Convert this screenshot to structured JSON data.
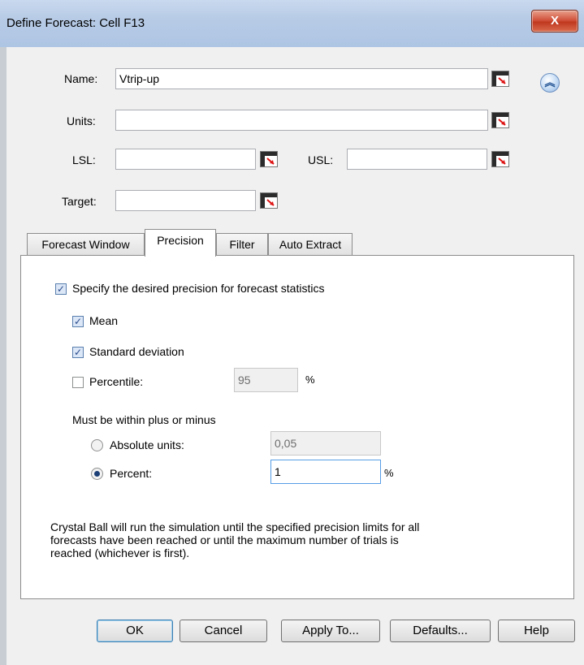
{
  "window": {
    "title": "Define Forecast: Cell F13",
    "close_glyph": "X"
  },
  "form": {
    "name_label": "Name:",
    "name_value": "Vtrip-up",
    "units_label": "Units:",
    "units_value": "",
    "lsl_label": "LSL:",
    "lsl_value": "",
    "usl_label": "USL:",
    "usl_value": "",
    "target_label": "Target:",
    "target_value": "",
    "collapse_glyph": "︽"
  },
  "tabs": [
    {
      "label": "Forecast Window",
      "active": false
    },
    {
      "label": "Precision",
      "active": true
    },
    {
      "label": "Filter",
      "active": false
    },
    {
      "label": "Auto Extract",
      "active": false
    }
  ],
  "precision": {
    "specify_label": "Specify the desired precision for forecast statistics",
    "specify_checked": true,
    "mean_label": "Mean",
    "mean_checked": true,
    "stddev_label": "Standard deviation",
    "stddev_checked": true,
    "percentile_label": "Percentile:",
    "percentile_checked": false,
    "percentile_value": "95",
    "percentile_unit": "%",
    "within_label": "Must be within plus or minus",
    "absolute_label": "Absolute units:",
    "absolute_value": "0,05",
    "absolute_selected": false,
    "percent_label": "Percent:",
    "percent_value": "1",
    "percent_unit": "%",
    "percent_selected": true,
    "note_line1": "Crystal Ball will run the simulation until the specified precision limits for all",
    "note_line2": "forecasts have been reached or until the maximum number of trials is",
    "note_line3": "reached (whichever is first)."
  },
  "buttons": {
    "ok": "OK",
    "cancel": "Cancel",
    "apply_to": "Apply To...",
    "defaults": "Defaults...",
    "help": "Help"
  },
  "icons": {
    "cell_reference": "cell-reference-icon",
    "collapse": "collapse-up-icon",
    "check": "✓"
  },
  "colors": {
    "title_bar": "#b7cbe6",
    "close_button": "#c0391f",
    "dialog_bg": "#f0f0f0",
    "focus_border": "#569de5"
  }
}
